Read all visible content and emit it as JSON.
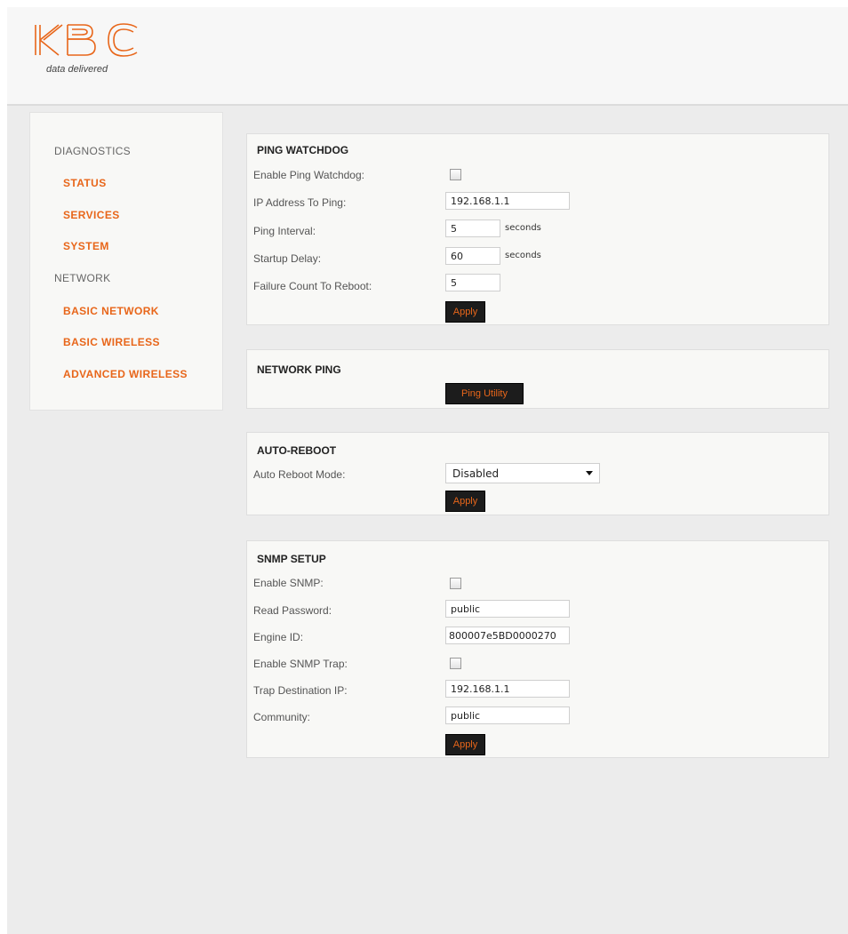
{
  "brand": {
    "logo_text": "KBC",
    "tagline": "data delivered",
    "accent": "#e8661a"
  },
  "sidebar": {
    "sections": [
      {
        "heading": "DIAGNOSTICS",
        "items": [
          "STATUS",
          "SERVICES",
          "SYSTEM"
        ]
      },
      {
        "heading": "NETWORK",
        "items": [
          "BASIC NETWORK",
          "BASIC WIRELESS",
          "ADVANCED WIRELESS"
        ]
      }
    ]
  },
  "ping_watchdog": {
    "title": "PING WATCHDOG",
    "enable_label": "Enable Ping Watchdog:",
    "enable_checked": false,
    "ip_label": "IP Address To Ping:",
    "ip_value": "192.168.1.1",
    "interval_label": "Ping Interval:",
    "interval_value": "5",
    "interval_unit": "seconds",
    "startup_label": "Startup Delay:",
    "startup_value": "60",
    "startup_unit": "seconds",
    "failure_label": "Failure Count To Reboot:",
    "failure_value": "5",
    "apply_label": "Apply"
  },
  "network_ping": {
    "title": "NETWORK PING",
    "button_label": "Ping Utility"
  },
  "auto_reboot": {
    "title": "AUTO-REBOOT",
    "mode_label": "Auto Reboot Mode:",
    "mode_value": "Disabled",
    "apply_label": "Apply"
  },
  "snmp": {
    "title": "SNMP SETUP",
    "enable_label": "Enable SNMP:",
    "enable_checked": false,
    "read_password_label": "Read Password:",
    "read_password_value": "public",
    "engine_id_label": "Engine ID:",
    "engine_id_value": "800007e5BD0000270",
    "enable_trap_label": "Enable SNMP Trap:",
    "enable_trap_checked": false,
    "trap_ip_label": "Trap Destination IP:",
    "trap_ip_value": "192.168.1.1",
    "community_label": "Community:",
    "community_value": "public",
    "apply_label": "Apply"
  }
}
